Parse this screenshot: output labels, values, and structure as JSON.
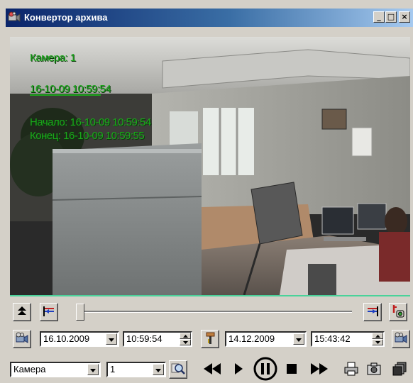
{
  "window": {
    "title": "Конвертор архива",
    "minimize_glyph": "_",
    "maximize_glyph": "□",
    "close_glyph": "×"
  },
  "video": {
    "camera_label": "Камера: 1",
    "current_timestamp": "16-10-09 10:59:54",
    "start_label": "Начало: 16-10-09 10:59:54",
    "end_label": "Конец: 16-10-09 10:59:55",
    "osd_color": "#1ca81c"
  },
  "timeline": {
    "position": 0.0
  },
  "range": {
    "start_date": "16.10.2009",
    "start_time": "10:59:54",
    "end_date": "14.12.2009",
    "end_time": "15:43:42"
  },
  "controls": {
    "source_type": "Камера",
    "source_number": "1"
  },
  "icons": {
    "app": "camera-app-icon",
    "collapse": "double-up-arrow-icon",
    "mark_start": "mark-start-icon",
    "mark_end": "mark-end-icon",
    "export_settings": "export-settings-icon",
    "rewind": "rewind-icon",
    "step_forward": "play-icon",
    "pause": "pause-icon",
    "stop": "stop-icon",
    "fast_forward": "fast-forward-icon",
    "print": "printer-icon",
    "snapshot": "camera-snapshot-icon",
    "copy": "copy-icon",
    "search": "search-icon"
  }
}
